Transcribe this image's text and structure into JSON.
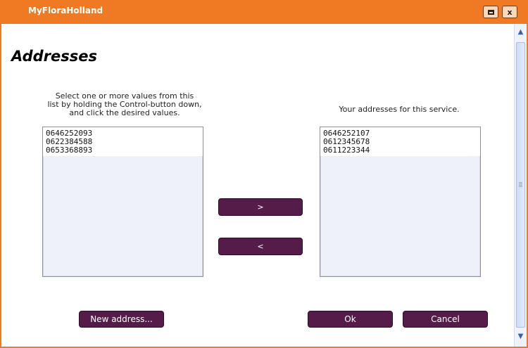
{
  "window": {
    "title": "MyFloraHolland",
    "restore_icon": "restore-icon",
    "close_icon": "close-icon",
    "close_glyph": "x"
  },
  "heading": "Addresses",
  "instructions": {
    "line1": "Select one or more values from this",
    "line2": "list by holding the Control-button down,",
    "line3": "and click the desired values."
  },
  "right_caption": "Your addresses for this service.",
  "available_addresses": [
    "0646252093",
    "0622384588",
    "0653368893"
  ],
  "selected_addresses": [
    "0646252107",
    "0612345678",
    "0611223344"
  ],
  "buttons": {
    "move_right": ">",
    "move_left": "<",
    "new_address": "New address...",
    "ok": "Ok",
    "cancel": "Cancel"
  },
  "scrollbar": {
    "up_arrow": "▲",
    "down_arrow": "▼"
  },
  "colors": {
    "title_bar": "#f07a24",
    "button": "#551c4a",
    "list_background": "#eef1fa"
  }
}
